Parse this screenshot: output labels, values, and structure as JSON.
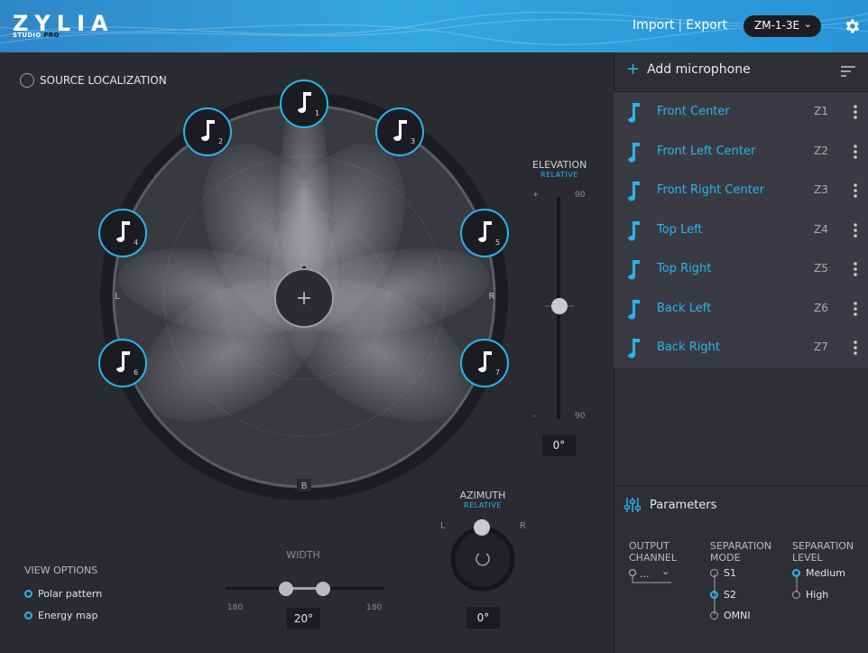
{
  "app": {
    "logo": "ZYLIA",
    "logo_sub_a": "STUDIO",
    "logo_sub_b": "PRO",
    "import_label": "Import",
    "separator": "|",
    "export_label": "Export",
    "device": "ZM-1-3E",
    "accent": "#28b5ee"
  },
  "source_localization": {
    "title": "SOURCE LOCALIZATION",
    "sources": [
      {
        "num": "1"
      },
      {
        "num": "2"
      },
      {
        "num": "3"
      },
      {
        "num": "4"
      },
      {
        "num": "5"
      },
      {
        "num": "6"
      },
      {
        "num": "7"
      }
    ],
    "left_label": "L",
    "right_label": "R",
    "back_label": "B",
    "center_icon": "plus-icon"
  },
  "elevation": {
    "title": "ELEVATION",
    "mode": "RELATIVE",
    "top_sign": "+",
    "top_value": "90",
    "bottom_sign": "-",
    "bottom_value": "90",
    "value": "0°"
  },
  "azimuth": {
    "title": "AZIMUTH",
    "mode": "RELATIVE",
    "left": "L",
    "right": "R",
    "value": "0°"
  },
  "width": {
    "title": "WIDTH",
    "min": "180",
    "max": "180",
    "value": "20°"
  },
  "view_options": {
    "title": "VIEW OPTIONS",
    "items": [
      "Polar pattern",
      "Energy map"
    ]
  },
  "microphones": {
    "add_label": "Add microphone",
    "list": [
      {
        "name": "Front Center",
        "code": "Z1"
      },
      {
        "name": "Front Left Center",
        "code": "Z2"
      },
      {
        "name": "Front Right Center",
        "code": "Z3"
      },
      {
        "name": "Top Left",
        "code": "Z4"
      },
      {
        "name": "Top Right",
        "code": "Z5"
      },
      {
        "name": "Back Left",
        "code": "Z6"
      },
      {
        "name": "Back Right",
        "code": "Z7"
      }
    ]
  },
  "parameters": {
    "title": "Parameters",
    "output_channel_l1": "OUTPUT",
    "output_channel_l2": "CHANNEL",
    "output_channel_value": "...",
    "separation_mode_l1": "SEPARATION",
    "separation_mode_l2": "MODE",
    "separation_modes": [
      "S1",
      "S2",
      "OMNI"
    ],
    "separation_level_l1": "SEPARATION",
    "separation_level_l2": "LEVEL",
    "separation_levels": [
      "Medium",
      "High"
    ]
  }
}
